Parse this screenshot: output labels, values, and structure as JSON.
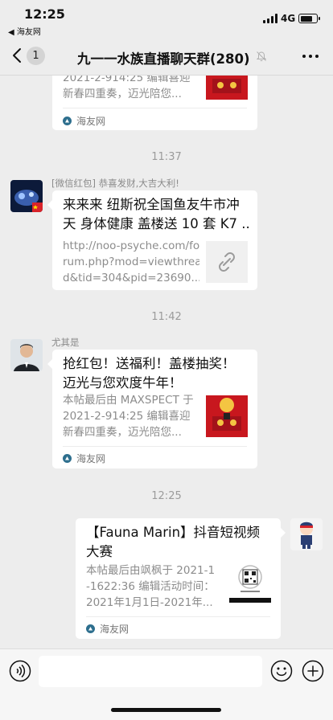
{
  "status_bar": {
    "time": "12:25",
    "back_app": "◀ 海友网",
    "network": "4G",
    "battery_level": 0.75
  },
  "nav": {
    "back_icon": "chevron-left-icon",
    "unread_count": "1",
    "title": "九一一水族直播聊天群(280)",
    "mute_icon": "bell-mute-icon",
    "more_icon": "more-dots-icon"
  },
  "messages": [
    {
      "kind": "card",
      "partial": true,
      "desc_lines": [
        "2021-2-914:25 编辑喜迎",
        "新春四重奏，迈光陪您..."
      ],
      "thumbnail": "red-envelope-image",
      "source": "海友网"
    },
    {
      "kind": "time",
      "text": "11:37"
    },
    {
      "kind": "card",
      "sender": "[微信红包] 恭喜发财,大吉大利!",
      "avatar": "avatar-fish-tank",
      "title_lines": [
        "来来来 纽斯祝全国鱼友牛市冲",
        "天 身体健康 盖楼送 10 套 K7 ..."
      ],
      "desc_lines": [
        "http://noo-psyche.com/fo",
        "rum.php?mod=viewthrea",
        "d&tid=304&pid=23690..."
      ],
      "thumbnail": "link-icon"
    },
    {
      "kind": "time",
      "text": "11:42"
    },
    {
      "kind": "card",
      "sender": "尤其是",
      "avatar": "avatar-man-suit",
      "title_lines": [
        "抢红包！送福利！盖楼抽奖！",
        "迈光与您欢度牛年！"
      ],
      "desc_lines": [
        "本帖最后由 MAXSPECT 于",
        "2021-2-914:25 编辑喜迎",
        "新春四重奏，迈光陪您..."
      ],
      "thumbnail": "red-envelope-image",
      "source": "海友网"
    },
    {
      "kind": "time",
      "text": "12:25"
    },
    {
      "kind": "card",
      "self": true,
      "avatar": "avatar-cartoon-diver",
      "title_lines": [
        "【Fauna Marin】抖音短视频",
        "大赛"
      ],
      "desc_lines": [
        "本帖最后由飒枫于 2021-1",
        "-1622:36 编辑活动时间：",
        "2021年1月1日-2021年..."
      ],
      "thumbnail": "qr-code-image",
      "source": "海友网"
    }
  ],
  "input_bar": {
    "voice_icon": "voice-icon",
    "input_value": "",
    "emoji_icon": "emoji-icon",
    "plus_icon": "plus-icon"
  }
}
